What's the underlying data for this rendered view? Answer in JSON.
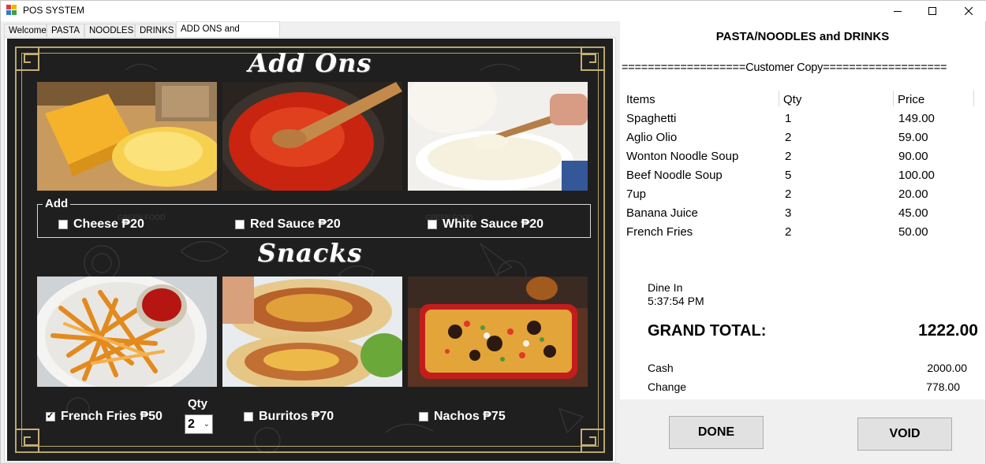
{
  "window": {
    "title": "POS SYSTEM"
  },
  "tabs": [
    "Welcome",
    "PASTA",
    "NOODLES",
    "DRINKS",
    "ADD ONS and SNACKS"
  ],
  "addons": {
    "heading": "Add Ons",
    "group_label": "Add",
    "items": [
      {
        "label": "Cheese ₱20",
        "checked": false
      },
      {
        "label": "Red Sauce ₱20",
        "checked": false
      },
      {
        "label": "White Sauce ₱20",
        "checked": false
      }
    ]
  },
  "snacks": {
    "heading": "Snacks",
    "qty_label": "Qty",
    "qty_value": "2",
    "items": [
      {
        "label": "French Fries ₱50",
        "checked": true
      },
      {
        "label": "Burritos ₱70",
        "checked": false
      },
      {
        "label": "Nachos ₱75",
        "checked": false
      }
    ]
  },
  "receipt": {
    "title": "PASTA/NOODLES and DRINKS",
    "copy_line": "===================Customer Copy===================",
    "columns": [
      "Items",
      "Qty",
      "Price"
    ],
    "rows": [
      {
        "item": "Spaghetti",
        "qty": "1",
        "price": "149.00"
      },
      {
        "item": "Aglio Olio",
        "qty": "2",
        "price": "59.00"
      },
      {
        "item": "Wonton Noodle Soup",
        "qty": "2",
        "price": "90.00"
      },
      {
        "item": "Beef Noodle Soup",
        "qty": "5",
        "price": "100.00"
      },
      {
        "item": "7up",
        "qty": "2",
        "price": "20.00"
      },
      {
        "item": "Banana Juice",
        "qty": "3",
        "price": "45.00"
      },
      {
        "item": "French Fries",
        "qty": "2",
        "price": "50.00"
      }
    ],
    "order_type": "Dine In",
    "time": "5:37:54 PM",
    "grand_total_label": "GRAND TOTAL:",
    "grand_total_value": "1222.00",
    "cash_label": "Cash",
    "cash_value": "2000.00",
    "change_label": "Change",
    "change_value": "778.00"
  },
  "buttons": {
    "done": "DONE",
    "void": "VOID"
  },
  "icons": {
    "app": "app-icon",
    "minimize": "minimize-icon",
    "maximize": "maximize-icon",
    "close": "close-icon",
    "dropdown": "chevron-down-icon"
  },
  "colors": {
    "board": "#1f1f1f",
    "frame_gold": "#b8a66a",
    "button_face": "#e1e1e1"
  }
}
